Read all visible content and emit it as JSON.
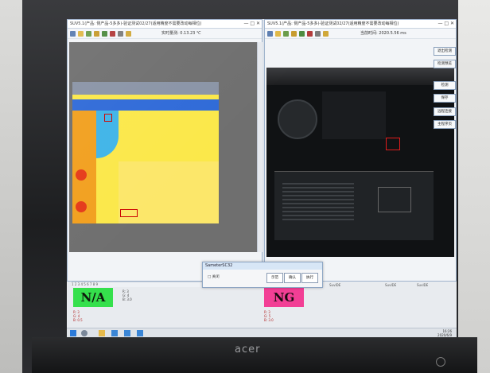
{
  "left_window": {
    "title": "SUV5.1(产品: 侧产品-5多多)-验证测试02/27(适用精度不需要改动每相位)",
    "toolbar_readout": "实时量测: 0.13.23 ℃",
    "window_controls": "— □ ✕"
  },
  "right_window": {
    "title": "SUV5.1(产品: 侧产品-5多多)-验证测试02/27(适用精度不需要改动每相位)",
    "toolbar_readout": "当前时间: 2020.5.56 ms",
    "window_controls": "— □ ✕",
    "buttons": [
      "退出检测",
      "检测预览",
      "检测",
      "保存",
      "远程连接",
      "主程序页"
    ]
  },
  "status": {
    "left_result": "N/A",
    "right_result": "NG",
    "left_status_text": "1 2 3 4 5 6 7 8 9",
    "left_readouts": [
      "R: 3",
      "G: 4",
      "B: 0.5",
      "R: 3",
      "G: 4",
      "B: 3.0"
    ],
    "right_readouts": [
      "R: 3",
      "G: 5",
      "B: 3.0"
    ],
    "right_status_labels": [
      "SuvIDE",
      "SuvIDE",
      "SuvIDE"
    ]
  },
  "dialog": {
    "title": "SameterSC32",
    "checkbox_label": "□ 关闭",
    "buttons": [
      "示范",
      "确认",
      "执行"
    ]
  },
  "taskbar": {
    "time": "16:26",
    "date": "2020/6/9"
  },
  "monitor_brand": "acer",
  "colors": {
    "na": "#35e04c",
    "ng": "#f23f95"
  }
}
